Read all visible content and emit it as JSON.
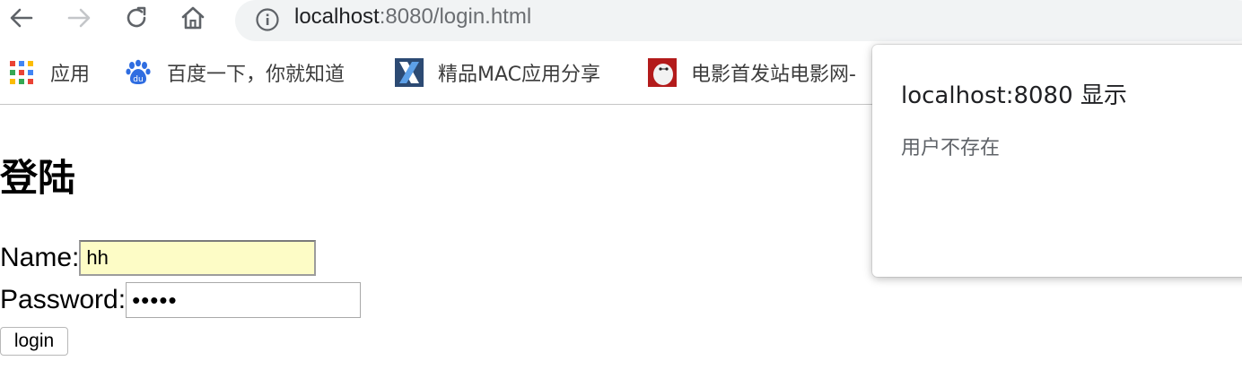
{
  "browser": {
    "url_host": "localhost",
    "url_rest": ":8080/login.html"
  },
  "bookmarks": [
    {
      "label": "应用",
      "icon": "apps-grid-icon"
    },
    {
      "label": "百度一下，你就知道",
      "icon": "baidu-paw-icon"
    },
    {
      "label": "精品MAC应用分享",
      "icon": "x-logo-icon"
    },
    {
      "label": "电影首发站电影网-",
      "icon": "movie-site-icon"
    }
  ],
  "page": {
    "heading": "登陆",
    "name_label": "Name:",
    "name_value": "hh",
    "password_label": "Password:",
    "password_masked": "•••••",
    "login_button": "login"
  },
  "alert": {
    "title": "localhost:8080 显示",
    "message": "用户不存在"
  }
}
